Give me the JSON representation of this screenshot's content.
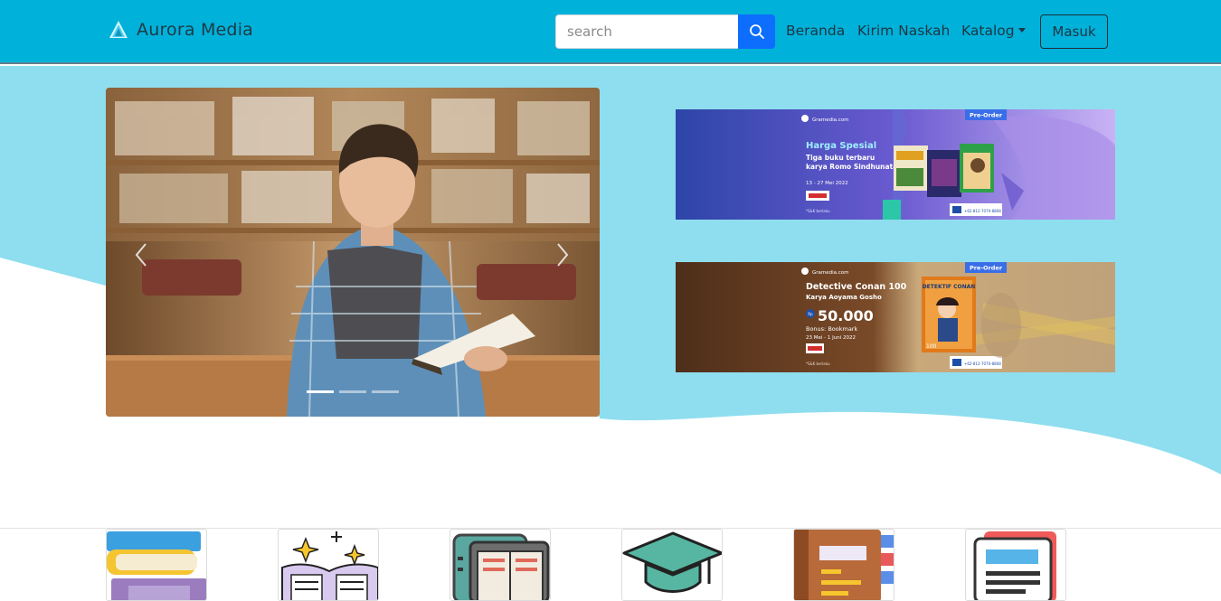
{
  "navbar": {
    "brand": "Aurora Media",
    "search_placeholder": "search",
    "links": [
      "Beranda",
      "Kirim Naskah",
      "Katalog"
    ],
    "login_label": "Masuk"
  },
  "carousel": {
    "slide_count": 3,
    "active_index": 0
  },
  "banners": [
    {
      "source": "Gramedia.com",
      "badge": "Pre-Order",
      "title": "Harga Spesial",
      "subtitle1": "Tiga buku terbaru",
      "subtitle2": "karya Romo Sindhunata",
      "date": "13 - 27 Mei 2022",
      "fine_print": "*S&K berlaku",
      "contact": "+62-812-7070-8808"
    },
    {
      "source": "Gramedia.com",
      "badge": "Pre-Order",
      "title": "Detective Conan 100",
      "subtitle1": "Karya Aoyama Gosho",
      "price_prefix": "Rp",
      "price": "50.000",
      "bonus": "Bonus: Bookmark",
      "date": "23 Mei - 1 Juni 2022",
      "fine_print": "*S&K berlaku",
      "contact": "+62-812-7070-8808",
      "cover_title": "DETEKTIF CONAN",
      "cover_number": "100"
    }
  ],
  "categories": [
    {
      "icon": "book-stack-icon"
    },
    {
      "icon": "magic-book-icon"
    },
    {
      "icon": "ebook-reader-icon"
    },
    {
      "icon": "graduation-cap-icon"
    },
    {
      "icon": "notebook-icon"
    },
    {
      "icon": "newspaper-icon"
    }
  ],
  "colors": {
    "navbar": "#00b1da",
    "hero_wave": "#8fdeef",
    "search_button": "#0d6efd"
  }
}
